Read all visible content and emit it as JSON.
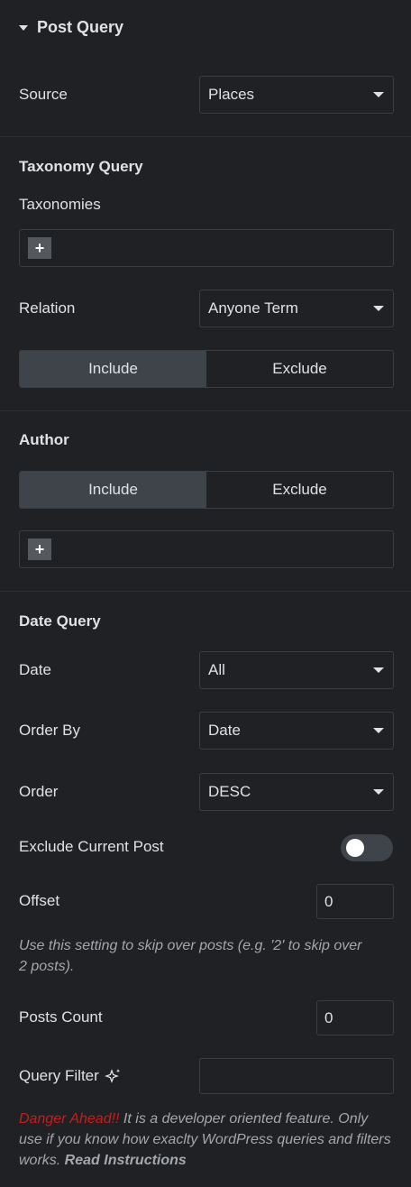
{
  "header": {
    "title": "Post Query"
  },
  "source": {
    "label": "Source",
    "value": "Places"
  },
  "taxonomy": {
    "section": "Taxonomy Query",
    "taxonomies_label": "Taxonomies",
    "relation_label": "Relation",
    "relation_value": "Anyone Term",
    "include": "Include",
    "exclude": "Exclude"
  },
  "author": {
    "section": "Author",
    "include": "Include",
    "exclude": "Exclude"
  },
  "date_query": {
    "section": "Date Query",
    "date_label": "Date",
    "date_value": "All",
    "orderby_label": "Order By",
    "orderby_value": "Date",
    "order_label": "Order",
    "order_value": "DESC",
    "exclude_current_label": "Exclude Current Post",
    "offset_label": "Offset",
    "offset_value": "0",
    "offset_note": "Use this setting to skip over posts (e.g. '2' to skip over 2 posts).",
    "posts_count_label": "Posts Count",
    "posts_count_value": "0",
    "query_filter_label": "Query Filter",
    "query_filter_value": "",
    "danger": "Danger Ahead!!",
    "danger_text": " It is a developer oriented feature. Only use if you know how exaclty WordPress queries and filters works. ",
    "read_instructions": "Read Instructions"
  },
  "colors": {
    "bg": "#1f2124",
    "danger": "#c41e1e",
    "active_segment": "#3f444b"
  }
}
